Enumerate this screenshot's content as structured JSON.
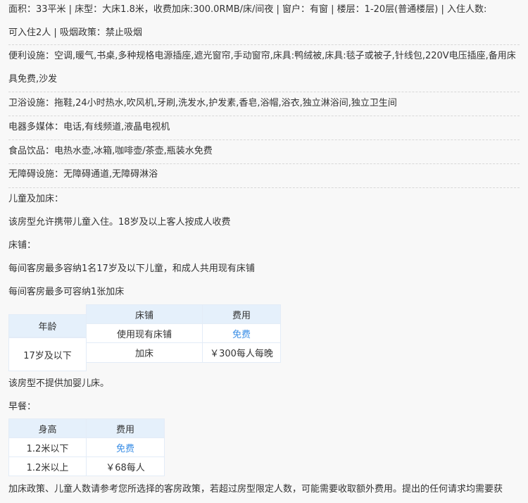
{
  "room_info": {
    "line1": "面积：33平米 | 床型：大床1.8米，收费加床:300.0RMB/床/间夜 | 窗户：有窗 | 楼层：1-20层(普通楼层) | 入住人数:",
    "line2": "可入住2人 | 吸烟政策：禁止吸烟"
  },
  "facilities": {
    "convenience_line1": "便利设施：空调,暖气,书桌,多种规格电源插座,遮光窗帘,手动窗帘,床具:鸭绒被,床具:毯子或被子,针线包,220V电压插座,备用床",
    "convenience_line2": "具免费,沙发",
    "bathroom": "卫浴设施：拖鞋,24小时热水,吹风机,牙刷,洗发水,护发素,香皂,浴帽,浴衣,独立淋浴间,独立卫生间",
    "media": "电器多媒体：电话,有线频道,液晶电视机",
    "food": "食品饮品：电热水壶,冰箱,咖啡壶/茶壶,瓶装水免费",
    "accessible": "无障碍设施：无障碍通道,无障碍淋浴"
  },
  "children": {
    "heading": "儿童及加床：",
    "policy": "该房型允许携带儿童入住。18岁及以上客人按成人收费",
    "bed_heading": "床铺：",
    "bed_rule1": "每间客房最多容纳1名17岁及以下儿童，和成人共用现有床铺",
    "bed_rule2": "每间客房最多可容纳1张加床",
    "table": {
      "age_header": "年龄",
      "bed_header": "床铺",
      "fee_header": "费用",
      "age_value": "17岁及以下",
      "rows": [
        {
          "bed": "使用现有床铺",
          "fee": "免费"
        },
        {
          "bed": "加床",
          "fee": "￥300每人每晚"
        }
      ]
    },
    "crib_note": "该房型不提供加婴儿床。"
  },
  "breakfast": {
    "heading": "早餐：",
    "table": {
      "height_header": "身高",
      "fee_header": "费用",
      "rows": [
        {
          "height": "1.2米以下",
          "fee": "免费"
        },
        {
          "height": "1.2米以上",
          "fee": "￥68每人"
        }
      ]
    }
  },
  "footer_note": "加床政策、儿童人数请参考您所选择的客房政策，若超过房型限定人数，可能需要收取额外费用。提出的任何请求均需要获",
  "colors": {
    "free_text": "#3a8ee6",
    "table_header_bg": "#e5f0fb",
    "table_border": "#e3ecf7"
  }
}
